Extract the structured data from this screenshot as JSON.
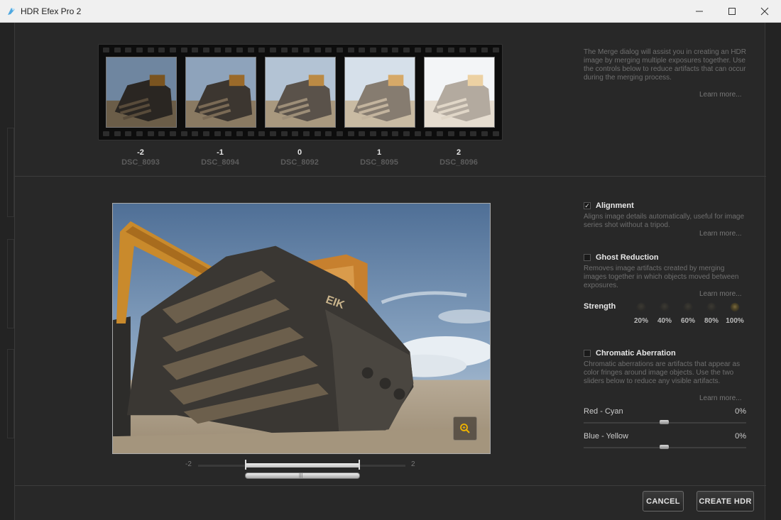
{
  "window": {
    "title": "HDR Efex Pro 2",
    "controls": [
      "minimize-icon",
      "maximize-icon",
      "close-icon"
    ]
  },
  "intro": {
    "text": "The Merge dialog will assist you in creating an HDR image by merging multiple exposures together. Use the controls below to reduce artifacts that can occur during the merging process.",
    "learn_more": "Learn more..."
  },
  "exposures": [
    {
      "ev": "-2",
      "file": "DSC_8093"
    },
    {
      "ev": "-1",
      "file": "DSC_8094"
    },
    {
      "ev": "0",
      "file": "DSC_8092"
    },
    {
      "ev": "1",
      "file": "DSC_8095"
    },
    {
      "ev": "2",
      "file": "DSC_8096"
    }
  ],
  "preview": {
    "slider_min": "-2",
    "slider_max": "2",
    "zoom_icon": "magnifier-icon"
  },
  "alignment": {
    "label": "Alignment",
    "checked": true,
    "description": "Aligns image details automatically, useful for image series shot without a tripod.",
    "learn_more": "Learn more..."
  },
  "ghost": {
    "label": "Ghost Reduction",
    "checked": false,
    "description": "Removes image artifacts created by merging images together in which objects moved between exposures.",
    "learn_more": "Learn more...",
    "strength_label": "Strength",
    "strength_options": [
      "20%",
      "40%",
      "60%",
      "80%",
      "100%"
    ],
    "strength_selected": "100%"
  },
  "chromatic": {
    "label": "Chromatic Aberration",
    "checked": false,
    "description": "Chromatic aberrations are artifacts that appear as color fringes around image objects. Use the two sliders below to reduce any visible artifacts.",
    "learn_more": "Learn more...",
    "red_cyan": {
      "label": "Red - Cyan",
      "value": "0%"
    },
    "blue_yellow": {
      "label": "Blue - Yellow",
      "value": "0%"
    }
  },
  "buttons": {
    "cancel": "CANCEL",
    "create": "CREATE HDR"
  }
}
